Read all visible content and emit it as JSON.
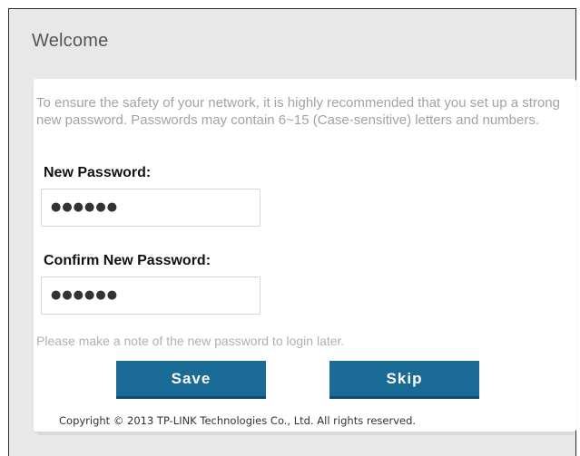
{
  "header": {
    "title": "Welcome"
  },
  "form": {
    "notice": "To ensure the safety of your network, it is highly recommended that you set up a strong new password. Passwords may contain 6~15 (Case-sensitive) letters and numbers.",
    "new_password_label": "New Password:",
    "new_password_value": "●●●●●●",
    "confirm_password_label": "Confirm New Password:",
    "confirm_password_value": "●●●●●●",
    "hint": "Please make a note of the new password to login later."
  },
  "actions": {
    "save_label": "Save",
    "skip_label": "Skip"
  },
  "footer": {
    "copyright": "Copyright © 2013 TP-LINK Technologies Co., Ltd. All rights reserved."
  },
  "colors": {
    "button": "#1a6a96",
    "panel_background": "#e8e8e8"
  }
}
